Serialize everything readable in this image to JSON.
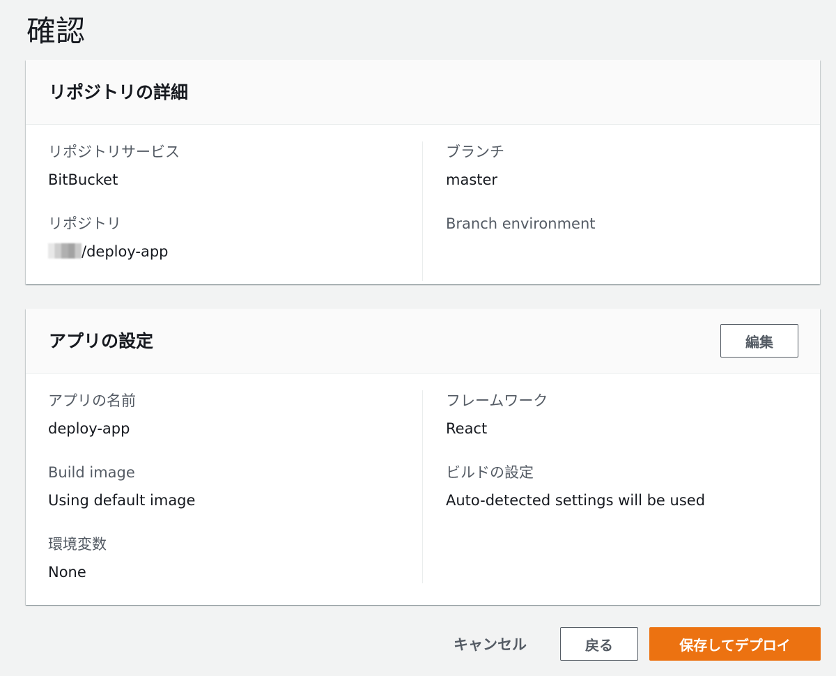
{
  "page": {
    "title": "確認"
  },
  "repo_panel": {
    "title": "リポジトリの詳細",
    "left": [
      {
        "label": "リポジトリサービス",
        "value": "BitBucket"
      },
      {
        "label": "リポジトリ",
        "value": "/deploy-app"
      }
    ],
    "right": [
      {
        "label": "ブランチ",
        "value": "master"
      },
      {
        "label": "Branch environment",
        "value": ""
      }
    ]
  },
  "app_panel": {
    "title": "アプリの設定",
    "edit_label": "編集",
    "left": [
      {
        "label": "アプリの名前",
        "value": "deploy-app"
      },
      {
        "label": "Build image",
        "value": "Using default image"
      },
      {
        "label": "環境変数",
        "value": "None"
      }
    ],
    "right": [
      {
        "label": "フレームワーク",
        "value": "React"
      },
      {
        "label": "ビルドの設定",
        "value": "Auto-detected settings will be used"
      }
    ]
  },
  "footer": {
    "cancel_label": "キャンセル",
    "back_label": "戻る",
    "deploy_label": "保存してデプロイ"
  },
  "colors": {
    "background": "#f2f3f3",
    "primary_button": "#ec7211",
    "text": "#16191f",
    "label": "#545b64"
  }
}
